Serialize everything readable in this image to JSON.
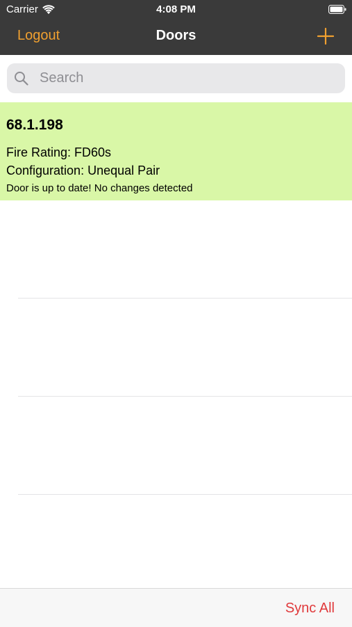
{
  "status_bar": {
    "carrier": "Carrier",
    "time": "4:08 PM"
  },
  "nav": {
    "left_label": "Logout",
    "title": "Doors",
    "add_icon": "plus-icon"
  },
  "search": {
    "placeholder": "Search"
  },
  "doors": [
    {
      "id": "68.1.198",
      "fire_rating": "Fire Rating: FD60s",
      "configuration": "Configuration: Unequal Pair",
      "status": "Door is up to date! No changes detected"
    }
  ],
  "toolbar": {
    "sync_label": "Sync All"
  },
  "colors": {
    "nav_background": "#3a3a3a",
    "accent": "#f0a030",
    "door_uptodate": "#d9f7a7",
    "sync_red": "#e0393b"
  }
}
